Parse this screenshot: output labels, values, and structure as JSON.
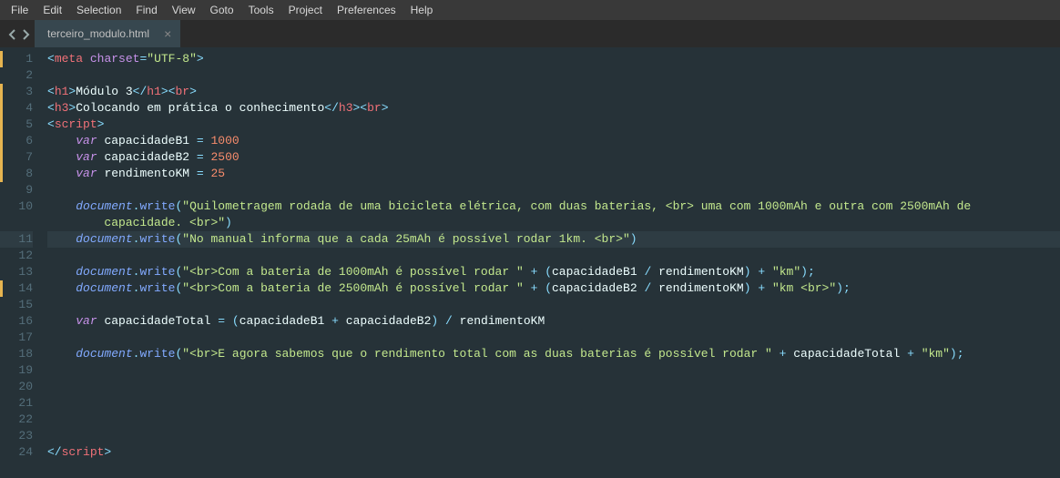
{
  "menu": {
    "items": [
      "File",
      "Edit",
      "Selection",
      "Find",
      "View",
      "Goto",
      "Tools",
      "Project",
      "Preferences",
      "Help"
    ]
  },
  "tabs": {
    "active": {
      "label": "terceiro_modulo.html",
      "close": "×"
    }
  },
  "editor": {
    "highlighted_line": 11,
    "modified_lines": [
      1,
      3,
      4,
      5,
      6,
      7,
      8,
      14
    ],
    "lines": [
      {
        "n": 1,
        "tokens": [
          {
            "c": "punc",
            "t": "<"
          },
          {
            "c": "tag",
            "t": "meta"
          },
          {
            "c": "text",
            "t": " "
          },
          {
            "c": "attr",
            "t": "charset"
          },
          {
            "c": "op",
            "t": "="
          },
          {
            "c": "str",
            "t": "\"UTF-8\""
          },
          {
            "c": "punc",
            "t": ">"
          }
        ]
      },
      {
        "n": 2,
        "tokens": []
      },
      {
        "n": 3,
        "tokens": [
          {
            "c": "punc",
            "t": "<"
          },
          {
            "c": "tag",
            "t": "h1"
          },
          {
            "c": "punc",
            "t": ">"
          },
          {
            "c": "text",
            "t": "Módulo 3"
          },
          {
            "c": "punc",
            "t": "</"
          },
          {
            "c": "tag",
            "t": "h1"
          },
          {
            "c": "punc",
            "t": "><"
          },
          {
            "c": "tag",
            "t": "br"
          },
          {
            "c": "punc",
            "t": ">"
          }
        ]
      },
      {
        "n": 4,
        "tokens": [
          {
            "c": "punc",
            "t": "<"
          },
          {
            "c": "tag",
            "t": "h3"
          },
          {
            "c": "punc",
            "t": ">"
          },
          {
            "c": "text",
            "t": "Colocando em prática o conhecimento"
          },
          {
            "c": "punc",
            "t": "</"
          },
          {
            "c": "tag",
            "t": "h3"
          },
          {
            "c": "punc",
            "t": "><"
          },
          {
            "c": "tag",
            "t": "br"
          },
          {
            "c": "punc",
            "t": ">"
          }
        ]
      },
      {
        "n": 5,
        "tokens": [
          {
            "c": "punc",
            "t": "<"
          },
          {
            "c": "tag",
            "t": "script"
          },
          {
            "c": "punc",
            "t": ">"
          }
        ]
      },
      {
        "n": 6,
        "tokens": [
          {
            "c": "text",
            "t": "    "
          },
          {
            "c": "kw",
            "t": "var"
          },
          {
            "c": "text",
            "t": " "
          },
          {
            "c": "var",
            "t": "capacidadeB1"
          },
          {
            "c": "text",
            "t": " "
          },
          {
            "c": "op",
            "t": "="
          },
          {
            "c": "text",
            "t": " "
          },
          {
            "c": "num",
            "t": "1000"
          }
        ]
      },
      {
        "n": 7,
        "tokens": [
          {
            "c": "text",
            "t": "    "
          },
          {
            "c": "kw",
            "t": "var"
          },
          {
            "c": "text",
            "t": " "
          },
          {
            "c": "var",
            "t": "capacidadeB2"
          },
          {
            "c": "text",
            "t": " "
          },
          {
            "c": "op",
            "t": "="
          },
          {
            "c": "text",
            "t": " "
          },
          {
            "c": "num",
            "t": "2500"
          }
        ]
      },
      {
        "n": 8,
        "tokens": [
          {
            "c": "text",
            "t": "    "
          },
          {
            "c": "kw",
            "t": "var"
          },
          {
            "c": "text",
            "t": " "
          },
          {
            "c": "var",
            "t": "rendimentoKM"
          },
          {
            "c": "text",
            "t": " "
          },
          {
            "c": "op",
            "t": "="
          },
          {
            "c": "text",
            "t": " "
          },
          {
            "c": "num",
            "t": "25"
          }
        ]
      },
      {
        "n": 9,
        "tokens": []
      },
      {
        "n": 10,
        "tokens": [
          {
            "c": "text",
            "t": "    "
          },
          {
            "c": "obj",
            "t": "document"
          },
          {
            "c": "punc",
            "t": "."
          },
          {
            "c": "fn",
            "t": "write"
          },
          {
            "c": "punc",
            "t": "("
          },
          {
            "c": "str",
            "t": "\"Quilometragem rodada de uma bicicleta elétrica, com duas baterias, <br> uma com 1000mAh e outra com 2500mAh de "
          }
        ]
      },
      {
        "n": "",
        "cont": true,
        "tokens": [
          {
            "c": "text",
            "t": "        "
          },
          {
            "c": "str",
            "t": "capacidade. <br>\""
          },
          {
            "c": "punc",
            "t": ")"
          }
        ]
      },
      {
        "n": 11,
        "hl": true,
        "tokens": [
          {
            "c": "text",
            "t": "    "
          },
          {
            "c": "obj",
            "t": "document"
          },
          {
            "c": "punc",
            "t": "."
          },
          {
            "c": "fn",
            "t": "write"
          },
          {
            "c": "punc",
            "t": "("
          },
          {
            "c": "str",
            "t": "\"No manual informa que a cada 25mAh é possível rodar 1km. <br>\""
          },
          {
            "c": "punc",
            "t": ")"
          }
        ]
      },
      {
        "n": 12,
        "tokens": []
      },
      {
        "n": 13,
        "tokens": [
          {
            "c": "text",
            "t": "    "
          },
          {
            "c": "obj",
            "t": "document"
          },
          {
            "c": "punc",
            "t": "."
          },
          {
            "c": "fn",
            "t": "write"
          },
          {
            "c": "punc",
            "t": "("
          },
          {
            "c": "str",
            "t": "\"<br>Com a bateria de 1000mAh é possível rodar \""
          },
          {
            "c": "text",
            "t": " "
          },
          {
            "c": "op",
            "t": "+"
          },
          {
            "c": "text",
            "t": " "
          },
          {
            "c": "punc",
            "t": "("
          },
          {
            "c": "var",
            "t": "capacidadeB1"
          },
          {
            "c": "text",
            "t": " "
          },
          {
            "c": "op",
            "t": "/"
          },
          {
            "c": "text",
            "t": " "
          },
          {
            "c": "var",
            "t": "rendimentoKM"
          },
          {
            "c": "punc",
            "t": ")"
          },
          {
            "c": "text",
            "t": " "
          },
          {
            "c": "op",
            "t": "+"
          },
          {
            "c": "text",
            "t": " "
          },
          {
            "c": "str",
            "t": "\"km\""
          },
          {
            "c": "punc",
            "t": ");"
          }
        ]
      },
      {
        "n": 14,
        "tokens": [
          {
            "c": "text",
            "t": "    "
          },
          {
            "c": "obj",
            "t": "document"
          },
          {
            "c": "punc",
            "t": "."
          },
          {
            "c": "fn",
            "t": "write"
          },
          {
            "c": "punc",
            "t": "("
          },
          {
            "c": "str",
            "t": "\"<br>Com a bateria de 2500mAh é possível rodar \""
          },
          {
            "c": "text",
            "t": " "
          },
          {
            "c": "op",
            "t": "+"
          },
          {
            "c": "text",
            "t": " "
          },
          {
            "c": "punc",
            "t": "("
          },
          {
            "c": "var",
            "t": "capacidadeB2"
          },
          {
            "c": "text",
            "t": " "
          },
          {
            "c": "op",
            "t": "/"
          },
          {
            "c": "text",
            "t": " "
          },
          {
            "c": "var",
            "t": "rendimentoKM"
          },
          {
            "c": "punc",
            "t": ")"
          },
          {
            "c": "text",
            "t": " "
          },
          {
            "c": "op",
            "t": "+"
          },
          {
            "c": "text",
            "t": " "
          },
          {
            "c": "str",
            "t": "\"km <br>\""
          },
          {
            "c": "punc",
            "t": ");"
          }
        ]
      },
      {
        "n": 15,
        "tokens": []
      },
      {
        "n": 16,
        "tokens": [
          {
            "c": "text",
            "t": "    "
          },
          {
            "c": "kw",
            "t": "var"
          },
          {
            "c": "text",
            "t": " "
          },
          {
            "c": "var",
            "t": "capacidadeTotal"
          },
          {
            "c": "text",
            "t": " "
          },
          {
            "c": "op",
            "t": "="
          },
          {
            "c": "text",
            "t": " "
          },
          {
            "c": "punc",
            "t": "("
          },
          {
            "c": "var",
            "t": "capacidadeB1"
          },
          {
            "c": "text",
            "t": " "
          },
          {
            "c": "op",
            "t": "+"
          },
          {
            "c": "text",
            "t": " "
          },
          {
            "c": "var",
            "t": "capacidadeB2"
          },
          {
            "c": "punc",
            "t": ")"
          },
          {
            "c": "text",
            "t": " "
          },
          {
            "c": "op",
            "t": "/"
          },
          {
            "c": "text",
            "t": " "
          },
          {
            "c": "var",
            "t": "rendimentoKM"
          }
        ]
      },
      {
        "n": 17,
        "tokens": []
      },
      {
        "n": 18,
        "tokens": [
          {
            "c": "text",
            "t": "    "
          },
          {
            "c": "obj",
            "t": "document"
          },
          {
            "c": "punc",
            "t": "."
          },
          {
            "c": "fn",
            "t": "write"
          },
          {
            "c": "punc",
            "t": "("
          },
          {
            "c": "str",
            "t": "\"<br>E agora sabemos que o rendimento total com as duas baterias é possível rodar \""
          },
          {
            "c": "text",
            "t": " "
          },
          {
            "c": "op",
            "t": "+"
          },
          {
            "c": "text",
            "t": " "
          },
          {
            "c": "var",
            "t": "capacidadeTotal"
          },
          {
            "c": "text",
            "t": " "
          },
          {
            "c": "op",
            "t": "+"
          },
          {
            "c": "text",
            "t": " "
          },
          {
            "c": "str",
            "t": "\"km\""
          },
          {
            "c": "punc",
            "t": ");"
          }
        ]
      },
      {
        "n": 19,
        "tokens": []
      },
      {
        "n": 20,
        "tokens": []
      },
      {
        "n": 21,
        "tokens": []
      },
      {
        "n": 22,
        "tokens": []
      },
      {
        "n": 23,
        "tokens": []
      },
      {
        "n": 24,
        "tokens": [
          {
            "c": "punc",
            "t": "</"
          },
          {
            "c": "tag",
            "t": "script"
          },
          {
            "c": "punc",
            "t": ">"
          }
        ]
      }
    ]
  }
}
